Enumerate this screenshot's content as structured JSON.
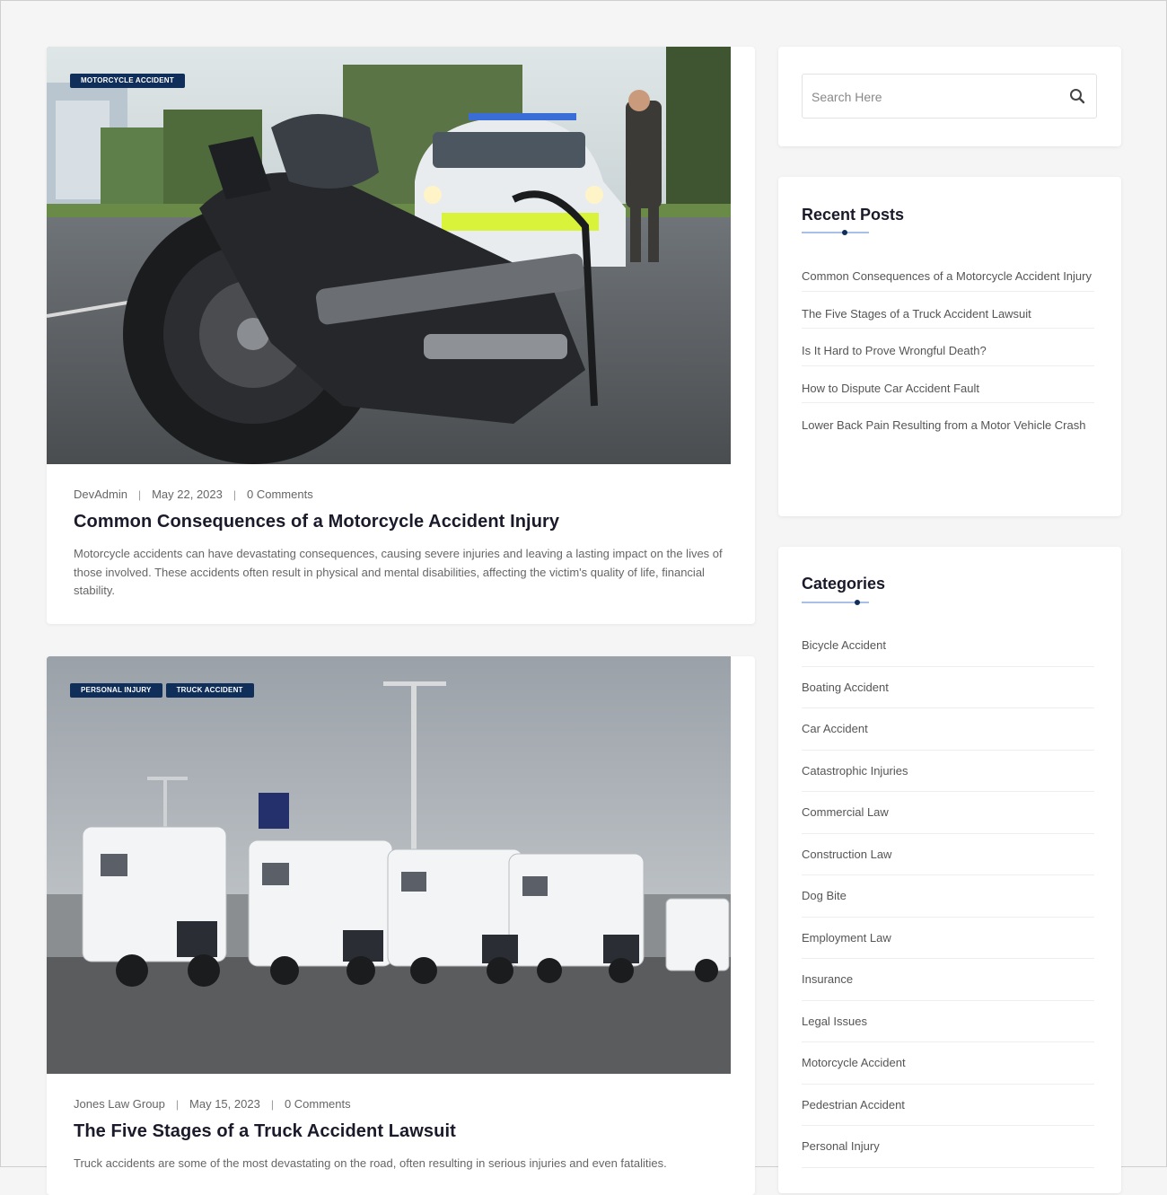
{
  "posts": [
    {
      "tags": [
        "MOTORCYCLE ACCIDENT"
      ],
      "author": "DevAdmin",
      "date": "May 22, 2023",
      "comments": "0 Comments",
      "title": "Common Consequences of a Motorcycle Accident Injury",
      "excerpt": "Motorcycle accidents can have devastating consequences, causing severe injuries and leaving a lasting impact on the lives of those involved. These accidents often result in physical and mental disabilities, affecting the victim's quality of life, financial stability."
    },
    {
      "tags": [
        "PERSONAL INJURY",
        "TRUCK ACCIDENT"
      ],
      "author": "Jones Law Group",
      "date": "May 15, 2023",
      "comments": "0 Comments",
      "title": "The Five Stages of a Truck Accident Lawsuit",
      "excerpt": "Truck accidents are some of the most devastating on the road, often resulting in serious injuries and even fatalities."
    }
  ],
  "sidebar": {
    "search": {
      "placeholder": "Search Here"
    },
    "recent_posts": {
      "title": "Recent Posts",
      "items": [
        "Common Consequences of a Motorcycle Accident Injury",
        "The Five Stages of a Truck Accident Lawsuit",
        "Is It Hard to Prove Wrongful Death?",
        "How to Dispute Car Accident Fault",
        "Lower Back Pain Resulting from a Motor Vehicle Crash"
      ]
    },
    "categories": {
      "title": "Categories",
      "items": [
        "Bicycle Accident",
        "Boating Accident",
        "Car Accident",
        "Catastrophic Injuries",
        "Commercial Law",
        "Construction Law",
        "Dog Bite",
        "Employment Law",
        "Insurance",
        "Legal Issues",
        "Motorcycle Accident",
        "Pedestrian Accident",
        "Personal Injury"
      ]
    }
  },
  "colors": {
    "tag_bg": "#0f2e5a",
    "accent_line": "#a9bfe6",
    "page_bg": "#f5f5f5"
  }
}
